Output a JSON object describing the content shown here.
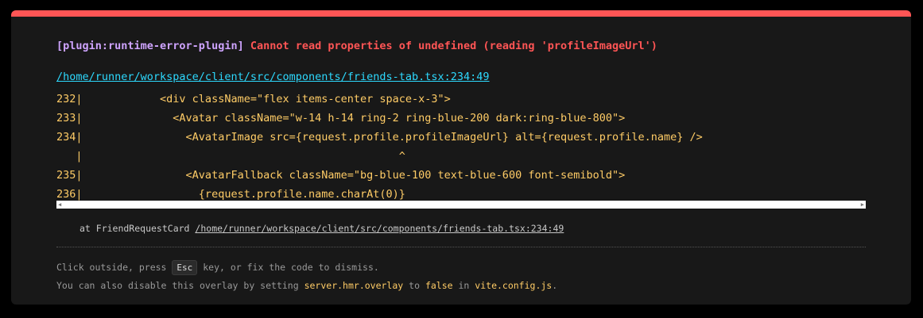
{
  "error": {
    "plugin": "[plugin:runtime-error-plugin]",
    "message": "Cannot read properties of undefined (reading 'profileImageUrl')",
    "file": "/home/runner/workspace/client/src/components/friends-tab.tsx:234:49"
  },
  "frame": {
    "lines": [
      "232|            <div className=\"flex items-center space-x-3\">",
      "233|              <Avatar className=\"w-14 h-14 ring-2 ring-blue-200 dark:ring-blue-800\">",
      "234|                <AvatarImage src={request.profile.profileImageUrl} alt={request.profile.name} />",
      "   |                                                 ^",
      "235|                <AvatarFallback className=\"bg-blue-100 text-blue-600 font-semibold\">",
      "236|                  {request.profile.name.charAt(0)}"
    ]
  },
  "stack": {
    "prefix": "at FriendRequestCard",
    "link": "/home/runner/workspace/client/src/components/friends-tab.tsx:234:49"
  },
  "tips": {
    "line1_pre": "Click outside, press",
    "esc_key": "Esc",
    "line1_post": "key, or fix the code to dismiss.",
    "line2_pre": "You can also disable this overlay by setting",
    "line2_code1": "server.hmr.overlay",
    "line2_mid": "to",
    "line2_code2": "false",
    "line2_mid2": "in",
    "line2_code3": "vite.config.js",
    "line2_post": "."
  },
  "icons": {
    "scroll_left": "scroll-left-arrow-icon",
    "scroll_right": "scroll-right-arrow-icon"
  },
  "colors": {
    "accent_bar": "#ff5555",
    "plugin": "#cfa4ff",
    "message": "#ff5555",
    "file_link": "#2dd9fe",
    "code": "#ffcc66",
    "background": "#181818"
  }
}
